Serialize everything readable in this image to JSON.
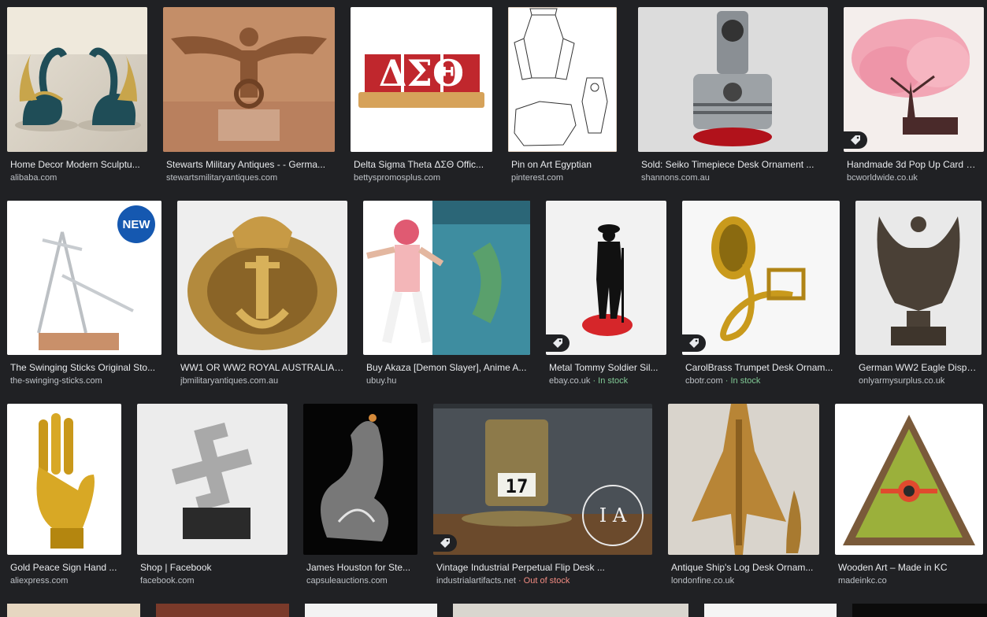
{
  "results": [
    {
      "title": "Home Decor Modern Sculptu...",
      "source": "alibaba.com"
    },
    {
      "title": "Stewarts Military Antiques - - Germa...",
      "source": "stewartsmilitaryantiques.com"
    },
    {
      "title": "Delta Sigma Theta ΔΣΘ Offic...",
      "source": "bettyspromosplus.com",
      "letters": "ΔΣΘ"
    },
    {
      "title": "Pin on Art Egyptian",
      "source": "pinterest.com"
    },
    {
      "title": "Sold: Seiko Timepiece Desk Ornament ...",
      "source": "shannons.com.au"
    },
    {
      "title": "Handmade 3d Pop Up Card C...",
      "source": "bcworldwide.co.uk"
    },
    {
      "title": "The Swinging Sticks Original Sto...",
      "source": "the-swinging-sticks.com",
      "badge": "NEW"
    },
    {
      "title": "WW1 OR WW2 ROYAL AUSTRALIAN ...",
      "source": "jbmilitaryantiques.com.au"
    },
    {
      "title": "Buy Akaza [Demon Slayer], Anime A...",
      "source": "ubuy.hu"
    },
    {
      "title": "Metal Tommy Soldier Sil...",
      "source": "ebay.co.uk",
      "stock": " · In stock"
    },
    {
      "title": "CarolBrass Trumpet Desk Ornam...",
      "source": "cbotr.com",
      "stock": " · In stock"
    },
    {
      "title": "German WW2 Eagle Displa...",
      "source": "onlyarmysurplus.co.uk"
    },
    {
      "title": "Gold Peace Sign Hand ...",
      "source": "aliexpress.com"
    },
    {
      "title": "Shop | Facebook",
      "source": "facebook.com"
    },
    {
      "title": "James Houston for Ste...",
      "source": "capsuleauctions.com"
    },
    {
      "title": "Vintage Industrial Perpetual Flip Desk ...",
      "source": "industrialartifacts.net",
      "stock": " · Out of stock",
      "calendar_day": "17",
      "watermark": "I A"
    },
    {
      "title": "Antique Ship's Log Desk Ornam...",
      "source": "londonfine.co.uk"
    },
    {
      "title": "Wooden Art – Made in KC",
      "source": "madeinkc.co"
    }
  ],
  "colors": {
    "background": "#202124",
    "title_text": "#e8eaed",
    "source_text": "#bdc1c6",
    "in_stock": "#81c995",
    "out_of_stock": "#f28b82"
  }
}
